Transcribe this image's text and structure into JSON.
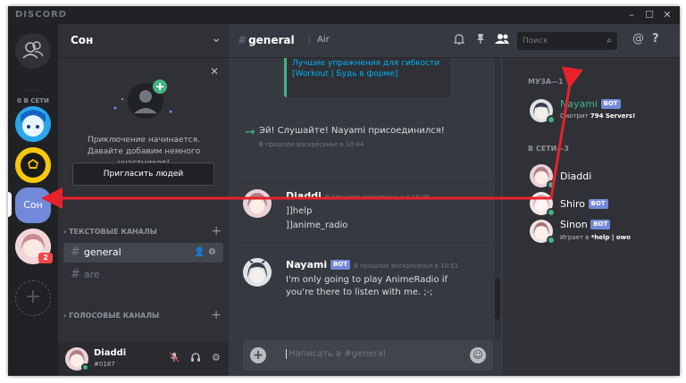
{
  "app": {
    "brand": "DISCORD",
    "window_controls": [
      "–",
      "☐",
      "✕"
    ]
  },
  "guilds": {
    "online_label": "0 В СЕТИ",
    "items": [
      {
        "label": "Сон",
        "color": "#7289da"
      },
      {
        "badge": "2"
      }
    ],
    "add_label": "+"
  },
  "server": {
    "name": "Сон"
  },
  "invite": {
    "text": "Приключение начинается. Давайте добавим немного участников!",
    "button": "Пригласить людей"
  },
  "categories": {
    "text": "ТЕКСТОВЫЕ КАНАЛЫ",
    "voice": "ГОЛОСОВЫЕ КАНАЛЫ"
  },
  "channels": [
    {
      "name": "general",
      "active": true
    },
    {
      "name": "are",
      "active": false
    }
  ],
  "user": {
    "name": "Diaddi",
    "tag": "#0187"
  },
  "chat": {
    "channel": "general",
    "topic": "Air",
    "search_placeholder": "Поиск",
    "embed_text": "Лучшие упражнения для гибкости [Workout | Будь в форме]",
    "join_text": "Эй! Слушайте! Nayami присоединился!",
    "join_time": "В прошлое воскресенье в 10:44",
    "messages": [
      {
        "author": "Diaddi",
        "time": "В прошлое воскресенье в 10:45",
        "lines": [
          "]]help",
          "]]anime_radio"
        ]
      },
      {
        "author": "Nayami",
        "bot": "BOT",
        "time": "В прошлое воскресенье в 10:51",
        "lines": [
          "I'm only going to play AnimeRadio if",
          "you're there to listen with me. ;-;"
        ]
      }
    ],
    "composer_placeholder": "Написать в #general"
  },
  "members": {
    "muse_header": "МУЗА—1",
    "online_header": "В СЕТИ—3",
    "list": [
      {
        "name": "Nayami",
        "bot": "BOT",
        "activity_prefix": "Смотрит",
        "activity_bold": "794 Servers!",
        "color": "#43b581"
      },
      {
        "name": "Diaddi"
      },
      {
        "name": "Shiro",
        "bot": "BOT"
      },
      {
        "name": "Sinon",
        "bot": "BOT",
        "activity_prefix": "Играет в",
        "activity_bold": "*help | owo"
      }
    ]
  },
  "colors": {
    "accent": "#7289da",
    "online": "#43b581",
    "arrow": "#e8222a",
    "mention_badge": "#f04747"
  }
}
